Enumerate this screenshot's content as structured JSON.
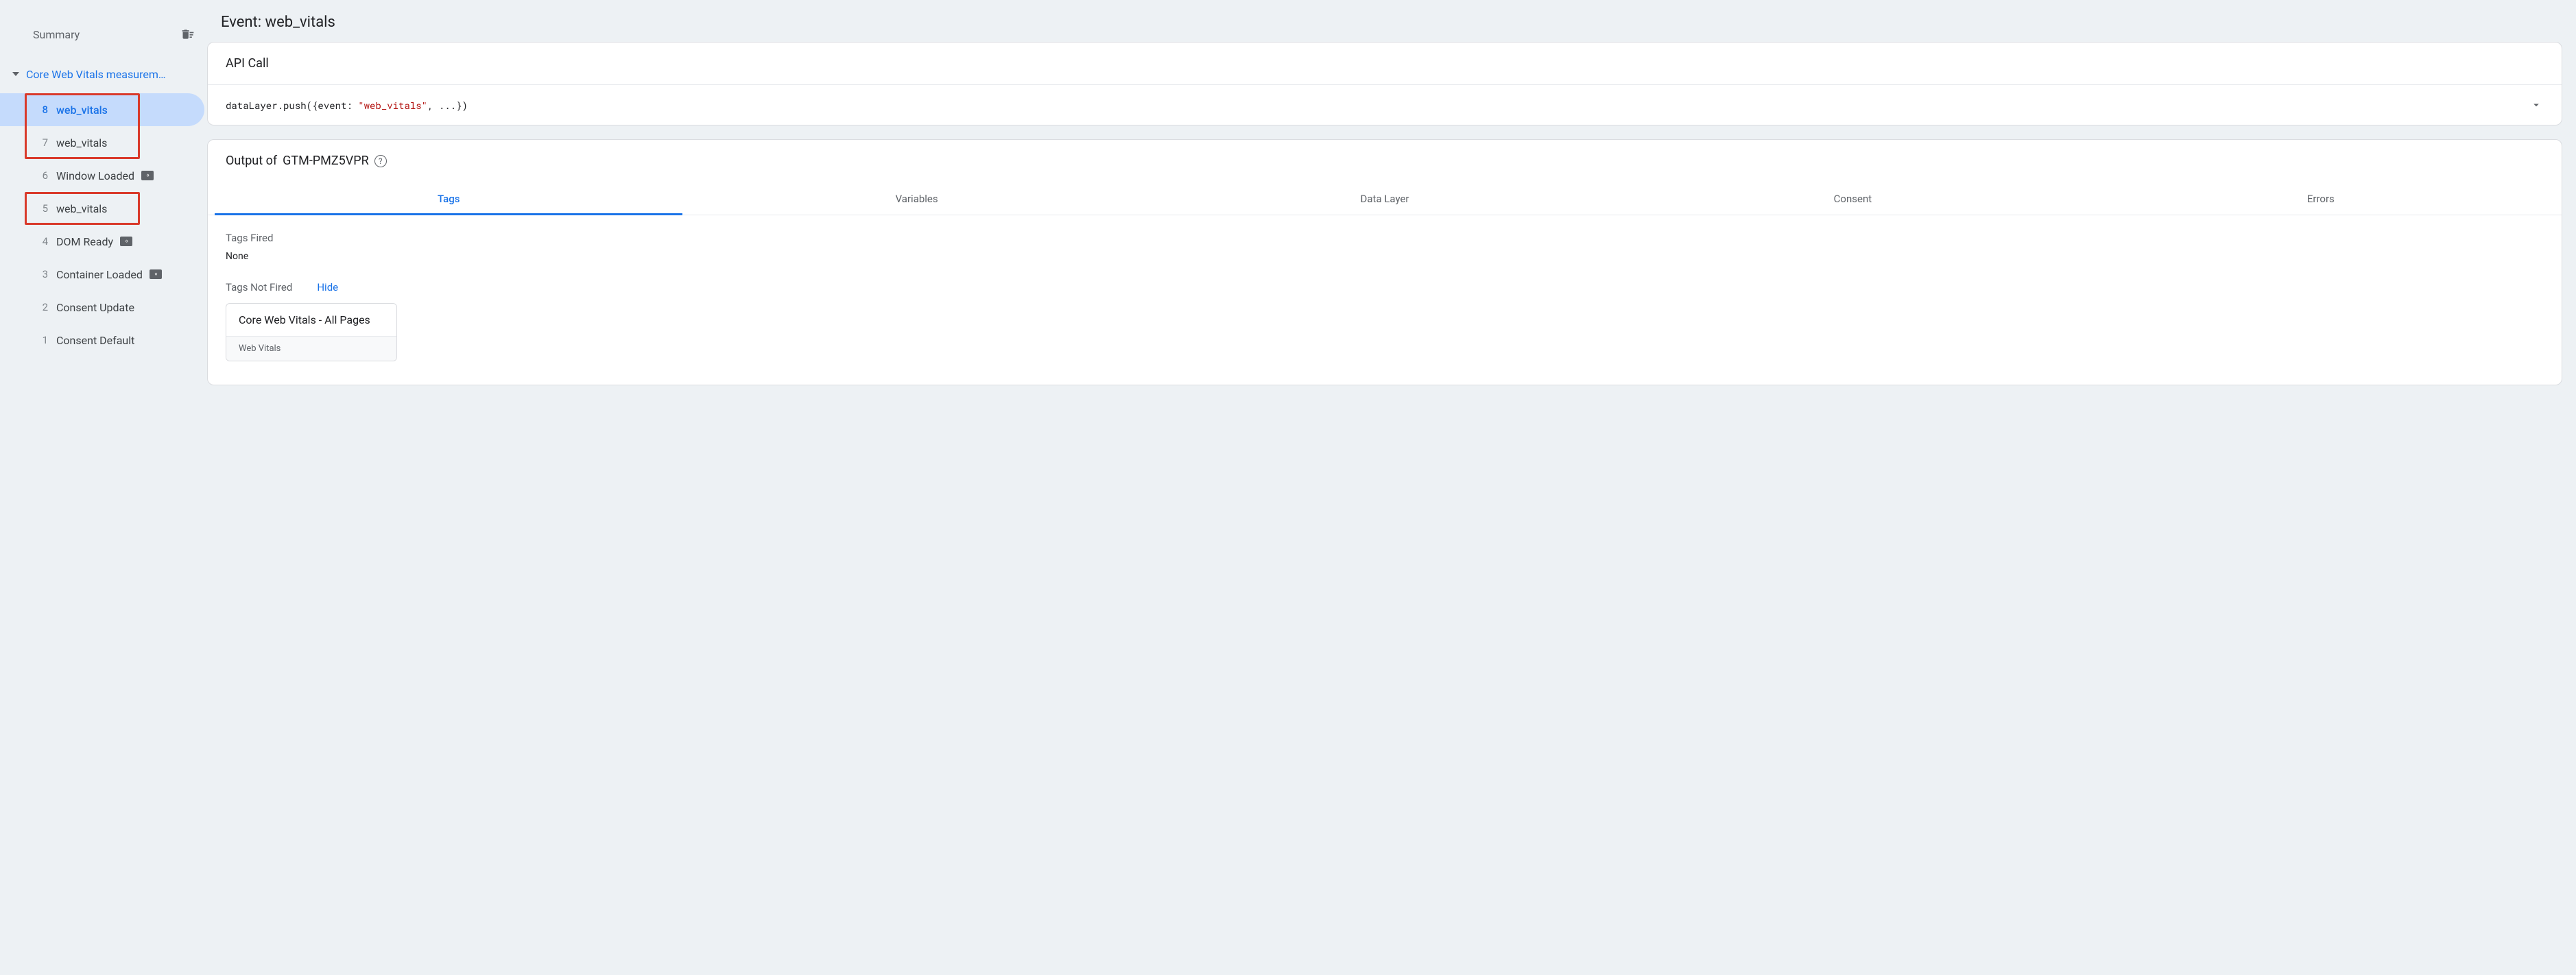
{
  "colors": {
    "accent": "#1a73e8",
    "highlight_border": "#d93a2b",
    "code_string": "#b31412"
  },
  "sidebar": {
    "summary_label": "Summary",
    "clear_icon": "delete-sweep-icon",
    "group_title": "Core Web Vitals measurem…",
    "events": [
      {
        "num": "8",
        "label": "web_vitals",
        "active": true,
        "badge": false,
        "highlight": "h1top"
      },
      {
        "num": "7",
        "label": "web_vitals",
        "active": false,
        "badge": false,
        "highlight": "h1bot"
      },
      {
        "num": "6",
        "label": "Window Loaded",
        "active": false,
        "badge": true,
        "highlight": null
      },
      {
        "num": "5",
        "label": "web_vitals",
        "active": false,
        "badge": false,
        "highlight": "h2"
      },
      {
        "num": "4",
        "label": "DOM Ready",
        "active": false,
        "badge": true,
        "highlight": null
      },
      {
        "num": "3",
        "label": "Container Loaded",
        "active": false,
        "badge": true,
        "highlight": null
      },
      {
        "num": "2",
        "label": "Consent Update",
        "active": false,
        "badge": false,
        "highlight": null
      },
      {
        "num": "1",
        "label": "Consent Default",
        "active": false,
        "badge": false,
        "highlight": null
      }
    ]
  },
  "main": {
    "event_title": "Event: web_vitals",
    "api_call": {
      "header": "API Call",
      "code_prefix": "dataLayer.push({event: ",
      "code_string": "\"web_vitals\"",
      "code_suffix": ", ...})"
    },
    "output": {
      "header_prefix": "Output of ",
      "container_id": "GTM-PMZ5VPR",
      "tabs": [
        {
          "label": "Tags",
          "active": true
        },
        {
          "label": "Variables",
          "active": false
        },
        {
          "label": "Data Layer",
          "active": false
        },
        {
          "label": "Consent",
          "active": false
        },
        {
          "label": "Errors",
          "active": false
        }
      ],
      "tags_fired_label": "Tags Fired",
      "tags_fired_value": "None",
      "tags_not_fired_label": "Tags Not Fired",
      "hide_label": "Hide",
      "not_fired_tag": {
        "name": "Core Web Vitals - All Pages",
        "type": "Web Vitals"
      }
    }
  }
}
